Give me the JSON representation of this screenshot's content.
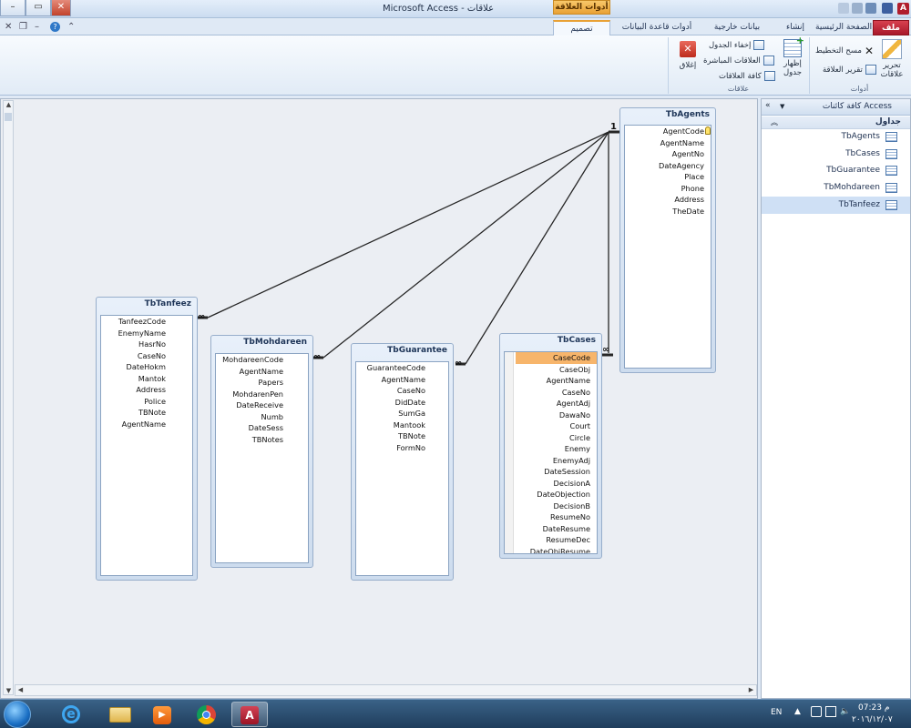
{
  "window": {
    "title": "Microsoft Access - علاقات",
    "context_tab_group": "أدوات العلاقة"
  },
  "tabs": {
    "file": "ملف",
    "home": "الصفحة الرئيسية",
    "create": "إنشاء",
    "external": "بيانات خارجية",
    "dbtools": "أدوات قاعدة البيانات",
    "design": "تصميم"
  },
  "ribbon": {
    "tools_group": "أدوات",
    "edit_rel": "تحرير علاقات",
    "clear_layout": "مسح التخطيط",
    "rel_report": "تقرير العلاقة",
    "rel_group": "علاقات",
    "show_table": "إظهار جدول",
    "hide_table": "إخفاء الجدول",
    "direct_rel": "العلاقات المباشرة",
    "all_rel": "كافة العلاقات",
    "close": "إغلاق"
  },
  "nav": {
    "header": "كافة كائنات Access",
    "group": "جداول",
    "items": [
      "TbAgents",
      "TbCases",
      "TbGuarantee",
      "TbMohdareen",
      "TbTanfeez"
    ],
    "selected": "TbTanfeez"
  },
  "tables": {
    "agents": {
      "name": "TbAgents",
      "fields": [
        "AgentCode",
        "AgentName",
        "AgentNo",
        "DateAgency",
        "Place",
        "Phone",
        "Address",
        "TheDate"
      ]
    },
    "cases": {
      "name": "TbCases",
      "fields": [
        "CaseCode",
        "CaseObj",
        "AgentName",
        "CaseNo",
        "AgentAdj",
        "DawaNo",
        "Court",
        "Circle",
        "Enemy",
        "EnemyAdj",
        "DateSession",
        "DecisionA",
        "DateObjection",
        "DecisionB",
        "ResumeNo",
        "DateResume",
        "ResumeDec",
        "DateObjResume"
      ]
    },
    "guarantee": {
      "name": "TbGuarantee",
      "fields": [
        "GuaranteeCode",
        "AgentName",
        "CaseNo",
        "DidDate",
        "SumGa",
        "Mantook",
        "TBNote",
        "FormNo"
      ]
    },
    "mohdareen": {
      "name": "TbMohdareen",
      "fields": [
        "MohdareenCode",
        "AgentName",
        "Papers",
        "MohdarenPen",
        "DateReceive",
        "Numb",
        "DateSess",
        "TBNotes"
      ]
    },
    "tanfeez": {
      "name": "TbTanfeez",
      "fields": [
        "TanfeezCode",
        "EnemyName",
        "HasrNo",
        "CaseNo",
        "DateHokm",
        "Mantok",
        "Address",
        "Police",
        "TBNote",
        "AgentName"
      ]
    }
  },
  "relation_symbols": {
    "one": "1",
    "many": "∞"
  },
  "taskbar": {
    "lang": "EN",
    "time": "07:23 م",
    "date": "٢٠١٦/١٢/٠٧"
  },
  "icons": {
    "start": "windows-orb-icon",
    "ie": "internet-explorer-icon",
    "explorer": "folder-icon",
    "media": "media-player-icon",
    "chrome": "chrome-icon",
    "access": "access-icon"
  }
}
